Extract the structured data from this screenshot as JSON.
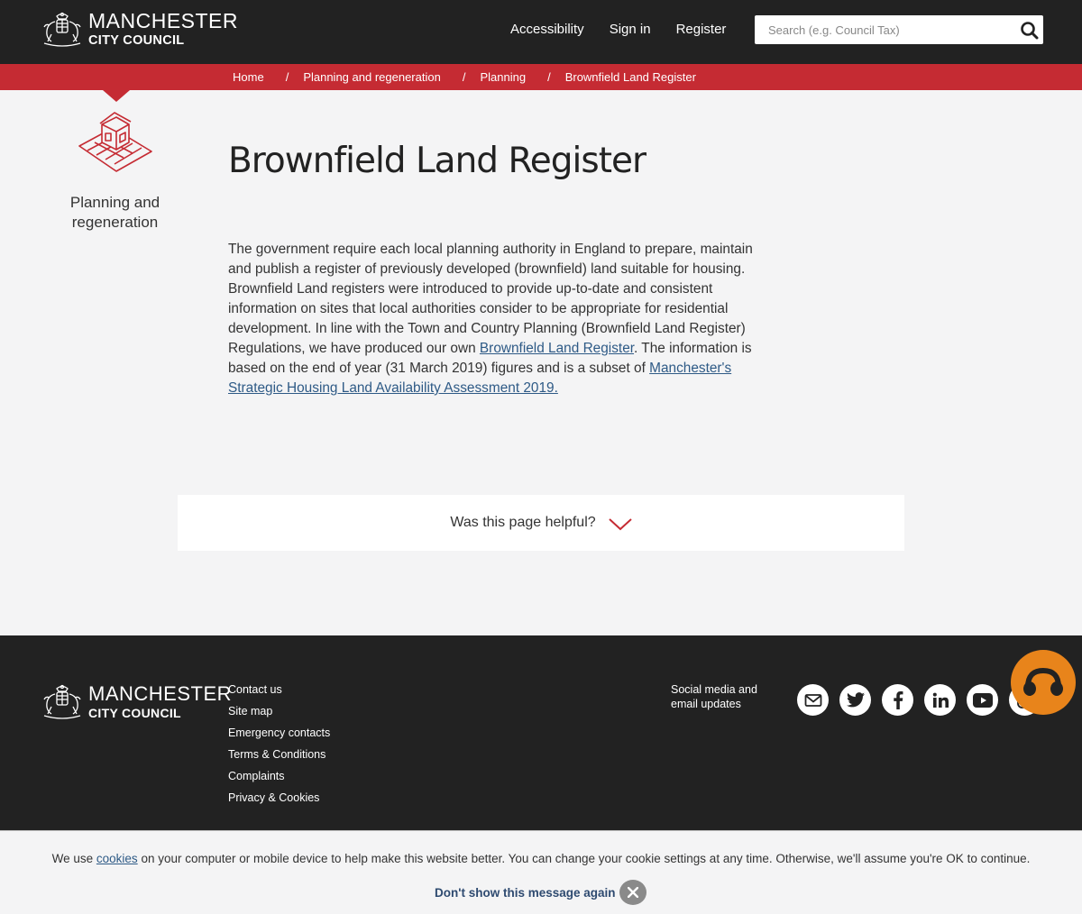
{
  "header": {
    "logo_line1": "MANCHESTER",
    "logo_line2": "CITY COUNCIL",
    "nav": [
      "Accessibility",
      "Sign in",
      "Register"
    ],
    "search_placeholder": "Search (e.g. Council Tax)",
    "background": "#222222"
  },
  "breadcrumb": {
    "items": [
      "Home",
      "Planning and regeneration",
      "Planning",
      "Brownfield Land Register"
    ],
    "separator": "/",
    "background": "#c52b33"
  },
  "category": {
    "label": "Planning and regeneration",
    "icon": "house-plan-icon"
  },
  "main": {
    "title": "Brownfield Land Register",
    "intro_part1": "The government require each local planning authority in England to prepare, maintain and publish a register of previously developed (brownfield) land suitable for housing. Brownfield Land registers were introduced to provide up-to-date and consistent information on sites that local authorities consider to be appropriate for residential development. In line with the Town and Country Planning (Brownfield Land Register) Regulations, we have produced our own ",
    "intro_link1": "Brownfield Land Register",
    "intro_part2": ". The information is based on the end of year (31 March 2019) figures and is a subset of ",
    "intro_link2": "Manchester's Strategic Housing Land Availability Assessment 2019.",
    "link_color": "#2e5a86"
  },
  "helpful": {
    "label": "Was this page helpful?",
    "icon": "chevron-down-icon"
  },
  "footer": {
    "logo_line1": "MANCHESTER",
    "logo_line2": "CITY COUNCIL",
    "links": [
      "Contact us",
      "Site map",
      "Emergency contacts",
      "Terms & Conditions",
      "Complaints",
      "Privacy & Cookies"
    ],
    "social_label": "Social media and email updates",
    "social_icons": [
      "email-icon",
      "twitter-icon",
      "facebook-icon",
      "linkedin-icon",
      "youtube-icon",
      "instagram-icon"
    ],
    "help_icon": "headset-icon",
    "help_color": "#e8841b"
  },
  "cookie": {
    "text_before": "We use ",
    "link": "cookies",
    "text_after": " on your computer or mobile device to help make this website better. You can change your cookie settings at any time. Otherwise, we'll assume you're OK to continue.",
    "dismiss_label": "Don't show this message again"
  }
}
